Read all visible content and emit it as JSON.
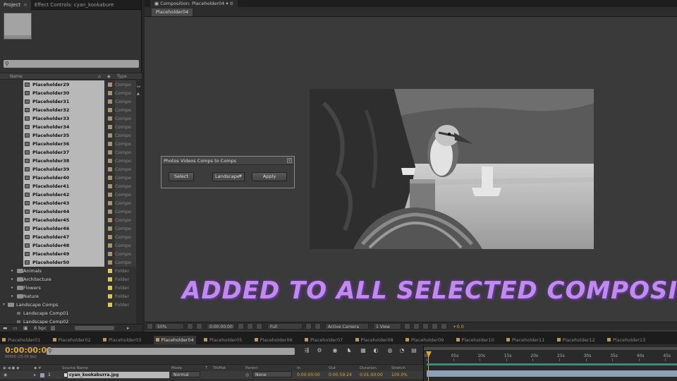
{
  "project_panel": {
    "tabs": [
      {
        "label": "Project",
        "close": "×"
      },
      {
        "label": "Effect Controls: cyan_kookabure",
        "close": "×"
      }
    ],
    "columns": {
      "name": "Name",
      "type": "Type"
    },
    "comps": [
      {
        "label": "Placeholder29",
        "type": "Compo"
      },
      {
        "label": "Placeholder30",
        "type": "Compo"
      },
      {
        "label": "Placeholder31",
        "type": "Compo"
      },
      {
        "label": "Placeholder32",
        "type": "Compo"
      },
      {
        "label": "Placeholder33",
        "type": "Compo"
      },
      {
        "label": "Placeholder34",
        "type": "Compo"
      },
      {
        "label": "Placeholder35",
        "type": "Compo"
      },
      {
        "label": "Placeholder36",
        "type": "Compo"
      },
      {
        "label": "Placeholder37",
        "type": "Compo"
      },
      {
        "label": "Placeholder38",
        "type": "Compo"
      },
      {
        "label": "Placeholder39",
        "type": "Compo"
      },
      {
        "label": "Placeholder40",
        "type": "Compo"
      },
      {
        "label": "Placeholder41",
        "type": "Compo"
      },
      {
        "label": "Placeholder42",
        "type": "Compo"
      },
      {
        "label": "Placeholder43",
        "type": "Compo"
      },
      {
        "label": "Placeholder44",
        "type": "Compo"
      },
      {
        "label": "Placeholder45",
        "type": "Compo"
      },
      {
        "label": "Placeholder46",
        "type": "Compo"
      },
      {
        "label": "Placeholder47",
        "type": "Compo"
      },
      {
        "label": "Placeholder48",
        "type": "Compo"
      },
      {
        "label": "Placeholder49",
        "type": "Compo"
      },
      {
        "label": "Placeholder50",
        "type": "Compo"
      }
    ],
    "folders": [
      {
        "label": "Animals",
        "type": "Folder"
      },
      {
        "label": "Architecture",
        "type": "Folder"
      },
      {
        "label": "Flowers",
        "type": "Folder"
      },
      {
        "label": "Nature",
        "type": "Folder"
      },
      {
        "label": "Landscape Comps",
        "type": "Folder"
      }
    ],
    "sub_items": [
      {
        "label": "Landscape Comp01"
      },
      {
        "label": "Landscape Comp02"
      }
    ],
    "bpc": "8 bpc",
    "colors": {
      "comp_swatch": "#a8946a",
      "folder_swatch": "#e0c848"
    }
  },
  "composition": {
    "tab_label": "Composition: Placeholder04",
    "subtab_label": "Placeholder04",
    "toolbar": {
      "zoom": "50%",
      "timecode": "0:00:00:00",
      "resolution": "Full",
      "camera": "Active Camera",
      "view": "1 View",
      "exposure": "+0.0"
    }
  },
  "script_dialog": {
    "title": "Photos Videos Comps to Comps",
    "select_label": "Select",
    "dropdown_value": "Landscape",
    "apply_label": "Apply"
  },
  "caption": "ADDED TO ALL SELECTED COMPOSITIONS",
  "timeline": {
    "tabs": [
      "Placeholder01",
      "Placeholder02",
      "Placeholder03",
      "Placeholder04",
      "Placeholder05",
      "Placeholder06",
      "Placeholder07",
      "Placeholder08",
      "Placeholder09",
      "Placeholder10",
      "Placeholder11",
      "Placeholder12",
      "Placeholder13"
    ],
    "active_tab_index": 3,
    "current_time": "0:00:00:00",
    "fps": "00000 (25.00 fps)",
    "search_placeholder": "",
    "columns": {
      "source_name": "Source Name",
      "mode": "Mode",
      "t": "T",
      "trkmat": "TrkMat",
      "parent": "Parent",
      "in": "In",
      "out": "Out",
      "duration": "Duration",
      "stretch": "Stretch"
    },
    "layer": {
      "index": "1",
      "source_name": "cyan_kookaburra.jpg",
      "mode": "Normal",
      "parent": "None",
      "in": "0:00:00:00",
      "out": "0:00:59:24",
      "duration": "0:01:00:00",
      "stretch": "100.0%"
    },
    "ruler_ticks": [
      "0s",
      "05s",
      "10s",
      "15s",
      "20s",
      "25s",
      "30s",
      "35s",
      "40s",
      "45s"
    ],
    "colors": {
      "time": "#d9a63c",
      "tab_swatch": "#b79b5c"
    }
  }
}
